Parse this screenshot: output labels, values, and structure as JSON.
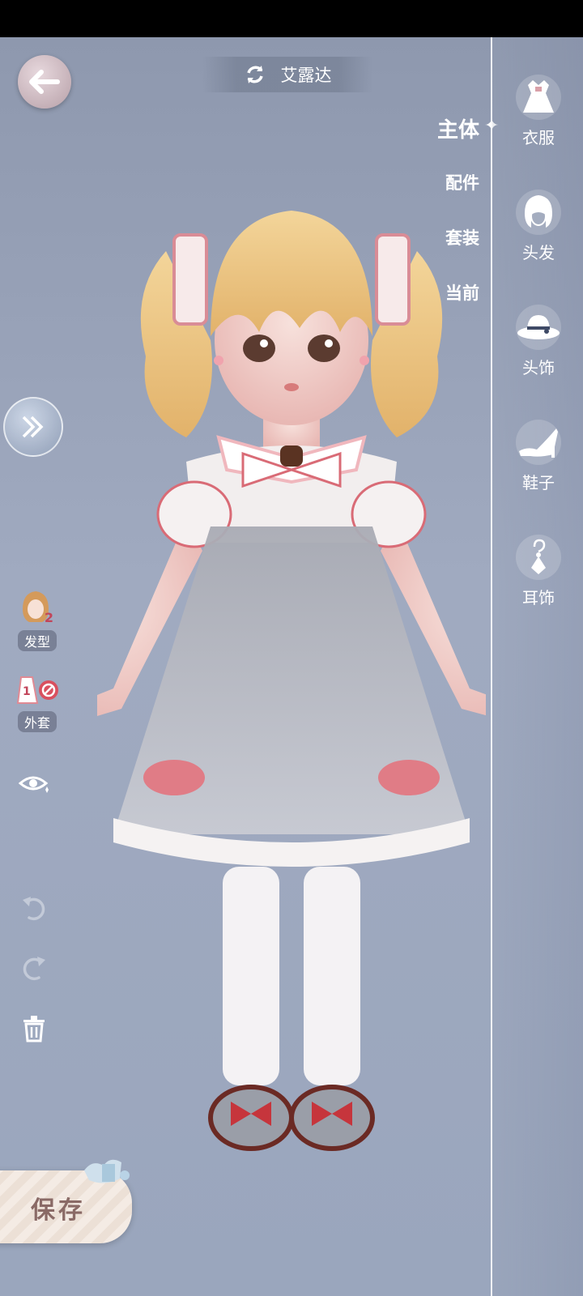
{
  "header": {
    "character_name": "艾露达"
  },
  "tabs": [
    {
      "label": "主体",
      "active": true
    },
    {
      "label": "配件",
      "active": false
    },
    {
      "label": "套装",
      "active": false
    },
    {
      "label": "当前",
      "active": false
    }
  ],
  "categories": [
    {
      "label": "衣服",
      "icon": "dress-icon"
    },
    {
      "label": "头发",
      "icon": "hair-icon"
    },
    {
      "label": "头饰",
      "icon": "hat-icon"
    },
    {
      "label": "鞋子",
      "icon": "shoe-icon"
    },
    {
      "label": "耳饰",
      "icon": "earring-icon"
    }
  ],
  "left_tools": {
    "hairstyle": {
      "label": "发型",
      "badge": "2"
    },
    "coat": {
      "label": "外套",
      "badge": "1"
    }
  },
  "save_label": "保存",
  "colors": {
    "accent": "#ffffff",
    "save_text": "#8a6a66",
    "background": "#9aa4bb",
    "dress_bow": "#e07c86"
  }
}
